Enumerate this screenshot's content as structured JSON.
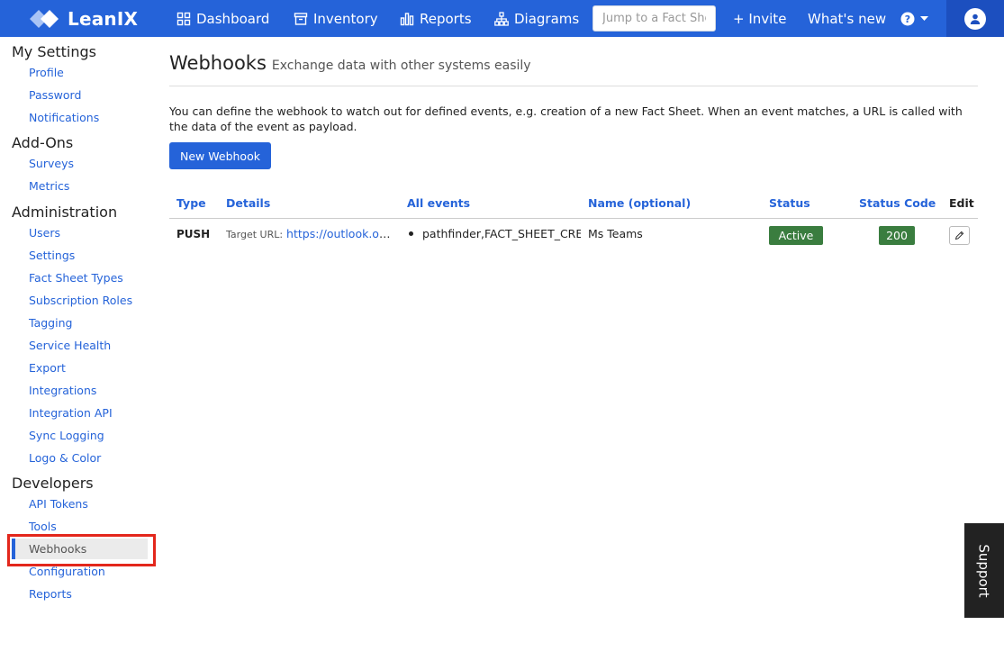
{
  "brand": {
    "name": "LeanIX",
    "color": "#2563d9"
  },
  "nav": {
    "dashboard": "Dashboard",
    "inventory": "Inventory",
    "reports": "Reports",
    "diagrams": "Diagrams",
    "search_placeholder": "Jump to a Fact Sheet",
    "invite": "+ Invite",
    "whats_new": "What's new"
  },
  "sidebar": {
    "my_settings": {
      "title": "My Settings",
      "items": [
        "Profile",
        "Password",
        "Notifications"
      ]
    },
    "addons": {
      "title": "Add-Ons",
      "items": [
        "Surveys",
        "Metrics"
      ]
    },
    "administration": {
      "title": "Administration",
      "items": [
        "Users",
        "Settings",
        "Fact Sheet Types",
        "Subscription Roles",
        "Tagging",
        "Service Health",
        "Export",
        "Integrations",
        "Integration API",
        "Sync Logging",
        "Logo & Color"
      ]
    },
    "developers": {
      "title": "Developers",
      "items": [
        "API Tokens",
        "Tools",
        "Webhooks",
        "Configuration",
        "Reports"
      ]
    },
    "active": "Webhooks"
  },
  "page": {
    "title": "Webhooks",
    "subtitle": "Exchange data with other systems easily",
    "description": "You can define the webhook to watch out for defined events, e.g. creation of a new Fact Sheet. When an event matches, a URL is called with the data of the event as payload.",
    "new_button": "New Webhook"
  },
  "table": {
    "headers": {
      "type": "Type",
      "details": "Details",
      "events": "All events",
      "name": "Name (optional)",
      "status": "Status",
      "status_code": "Status Code",
      "edit": "Edit"
    },
    "rows": [
      {
        "type": "PUSH",
        "target_label": "Target URL:",
        "target_url": "https://outlook.office.com/webhook",
        "event": "pathfinder,FACT_SHEET_CREATED",
        "name": "Ms Teams",
        "status": "Active",
        "status_code": "200"
      }
    ]
  },
  "support": "Support"
}
